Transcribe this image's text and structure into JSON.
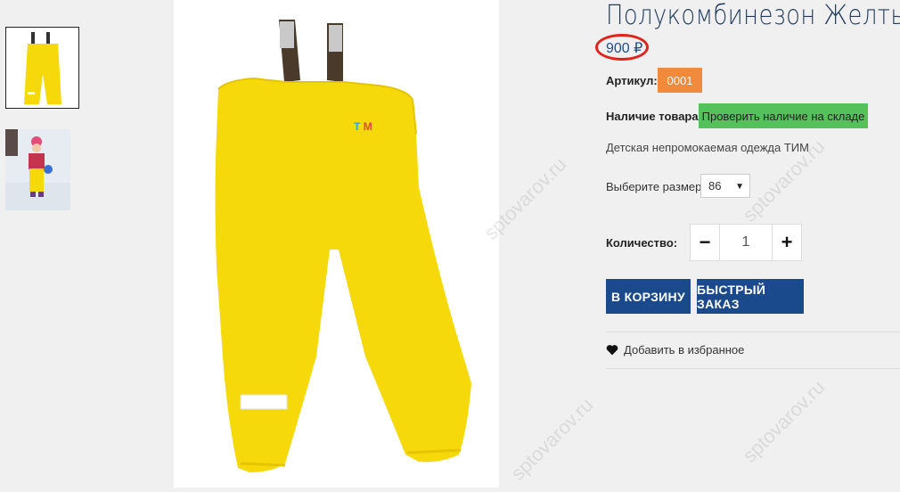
{
  "product": {
    "title": "Полукомбинезон Желтый",
    "price": "900 ₽",
    "sku_label": "Артикул:",
    "sku": "0001",
    "availability_label": "Наличие товара:",
    "availability_button": "Проверить наличие на складе",
    "description": "Детская непромокаемая одежда ТИМ",
    "size_label": "Выберите размер:",
    "size_value": "86",
    "quantity_label": "Количество:",
    "quantity_value": "1",
    "quantity_minus": "−",
    "quantity_plus": "+",
    "add_to_cart": "В КОРЗИНУ",
    "quick_order": "БЫСТРЫЙ ЗАКАЗ",
    "add_to_favorites": "Добавить в избранное"
  },
  "image": {
    "logo_text": "TIM"
  },
  "watermark": "sptovarov.ru",
  "colors": {
    "title": "#1f3b5c",
    "price": "#1f4e8c",
    "price_circle": "#e2231a",
    "sku_bg": "#f08a3c",
    "availability_bg": "#55c15a",
    "cta_bg": "#1a4a8c",
    "product_yellow": "#f5d90a"
  },
  "icons": {
    "favorite": "heart-icon",
    "select_arrow": "caret-down-icon"
  }
}
